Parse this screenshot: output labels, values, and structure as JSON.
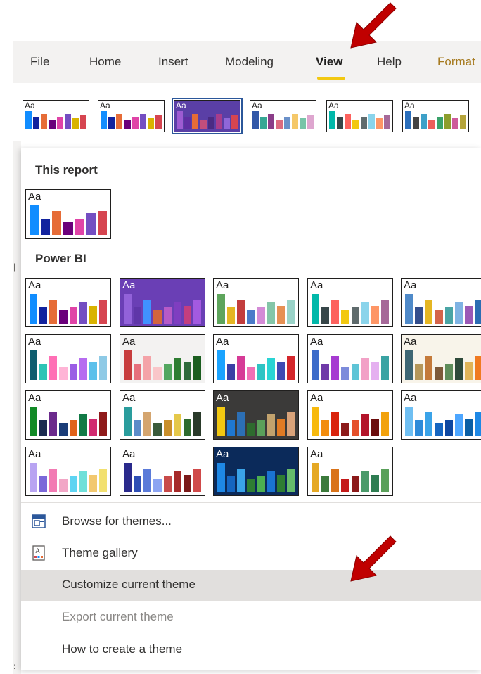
{
  "ribbon": {
    "tabs": [
      "File",
      "Home",
      "Insert",
      "Modeling",
      "View",
      "Help",
      "Format"
    ],
    "active_tab": "View",
    "gallery_thumbs": [
      {
        "label": "Aa",
        "bg": "#ffffff",
        "text": "#201f1e",
        "bars": [
          [
            "#118dff",
            100
          ],
          [
            "#12239e",
            70
          ],
          [
            "#e66c37",
            85
          ],
          [
            "#6b007b",
            55
          ],
          [
            "#e044a7",
            70
          ],
          [
            "#744ec2",
            85
          ],
          [
            "#d9b300",
            60
          ],
          [
            "#d64550",
            80
          ]
        ]
      },
      {
        "label": "Aa",
        "bg": "#ffffff",
        "text": "#201f1e",
        "bars": [
          [
            "#118dff",
            100
          ],
          [
            "#12239e",
            70
          ],
          [
            "#e66c37",
            85
          ],
          [
            "#6b007b",
            55
          ],
          [
            "#e044a7",
            70
          ],
          [
            "#744ec2",
            85
          ],
          [
            "#d9b300",
            60
          ],
          [
            "#d64550",
            80
          ]
        ]
      },
      {
        "label": "Aa",
        "bg": "#5a3fa6",
        "text": "#ffffff",
        "bars": [
          [
            "#9d5bd2",
            100
          ],
          [
            "#5f2ea3",
            70
          ],
          [
            "#e66c37",
            85
          ],
          [
            "#c24e7c",
            55
          ],
          [
            "#4a2b83",
            70
          ],
          [
            "#a73d8c",
            85
          ],
          [
            "#8f66d8",
            60
          ],
          [
            "#d64550",
            80
          ]
        ]
      },
      {
        "label": "Aa",
        "bg": "#ffffff",
        "text": "#201f1e",
        "bars": [
          [
            "#3257a8",
            100
          ],
          [
            "#37a794",
            70
          ],
          [
            "#8b3d88",
            85
          ],
          [
            "#dd6b7f",
            55
          ],
          [
            "#6b91c9",
            70
          ],
          [
            "#f5c869",
            85
          ],
          [
            "#77c4a8",
            60
          ],
          [
            "#dea6cf",
            80
          ]
        ]
      },
      {
        "label": "Aa",
        "bg": "#ffffff",
        "text": "#201f1e",
        "bars": [
          [
            "#01b8aa",
            100
          ],
          [
            "#374649",
            70
          ],
          [
            "#fd625e",
            85
          ],
          [
            "#f2c80f",
            55
          ],
          [
            "#5f6b6d",
            70
          ],
          [
            "#8ad4eb",
            85
          ],
          [
            "#fe9666",
            60
          ],
          [
            "#a66999",
            80
          ]
        ]
      },
      {
        "label": "Aa",
        "bg": "#ffffff",
        "text": "#201f1e",
        "bars": [
          [
            "#2a6ebb",
            100
          ],
          [
            "#444444",
            70
          ],
          [
            "#3da0c8",
            85
          ],
          [
            "#ee5f5b",
            55
          ],
          [
            "#39a26a",
            70
          ],
          [
            "#8d9e2d",
            85
          ],
          [
            "#ce5b9a",
            60
          ],
          [
            "#b5a43a",
            80
          ]
        ]
      }
    ]
  },
  "panel": {
    "this_report_title": "This report",
    "this_report_thumb": {
      "label": "Aa",
      "bg": "#ffffff",
      "text": "#201f1e",
      "bars": [
        [
          "#118dff",
          100
        ],
        [
          "#12239e",
          55
        ],
        [
          "#e66c37",
          80
        ],
        [
          "#6b007b",
          45
        ],
        [
          "#e044a7",
          55
        ],
        [
          "#744ec2",
          75
        ],
        [
          "#d64550",
          80
        ]
      ]
    },
    "power_bi_title": "Power BI",
    "power_bi_thumbs": [
      {
        "label": "Aa",
        "bg": "#ffffff",
        "text": "#201f1e",
        "bars": [
          [
            "#118dff",
            100
          ],
          [
            "#12239e",
            55
          ],
          [
            "#e66c37",
            80
          ],
          [
            "#6b007b",
            45
          ],
          [
            "#e044a7",
            55
          ],
          [
            "#744ec2",
            75
          ],
          [
            "#d9b300",
            60
          ],
          [
            "#d64550",
            80
          ]
        ]
      },
      {
        "label": "Aa",
        "bg": "#6a3fb5",
        "text": "#ffffff",
        "bars": [
          [
            "#9262d9",
            100
          ],
          [
            "#5f36a8",
            55
          ],
          [
            "#4092ff",
            80
          ],
          [
            "#d4653e",
            45
          ],
          [
            "#b75ac7",
            55
          ],
          [
            "#7f3ec0",
            75
          ],
          [
            "#c43e7f",
            60
          ],
          [
            "#a35ae0",
            80
          ]
        ]
      },
      {
        "label": "Aa",
        "bg": "#ffffff",
        "text": "#201f1e",
        "bars": [
          [
            "#5ea55c",
            100
          ],
          [
            "#e5b623",
            55
          ],
          [
            "#c33d3d",
            80
          ],
          [
            "#4a7bc9",
            45
          ],
          [
            "#d48bd6",
            55
          ],
          [
            "#84c6a8",
            75
          ],
          [
            "#e69054",
            60
          ],
          [
            "#9ad3c8",
            80
          ]
        ]
      },
      {
        "label": "Aa",
        "bg": "#ffffff",
        "text": "#201f1e",
        "bars": [
          [
            "#01b8aa",
            100
          ],
          [
            "#374649",
            55
          ],
          [
            "#fd625e",
            80
          ],
          [
            "#f2c80f",
            45
          ],
          [
            "#5f6b6d",
            55
          ],
          [
            "#8ad4eb",
            75
          ],
          [
            "#fe9666",
            60
          ],
          [
            "#a66999",
            80
          ]
        ]
      },
      {
        "label": "Aa",
        "bg": "#ffffff",
        "text": "#201f1e",
        "bars": [
          [
            "#4f8ac9",
            100
          ],
          [
            "#344e8c",
            55
          ],
          [
            "#e5b623",
            80
          ],
          [
            "#d4644b",
            45
          ],
          [
            "#4aa5a5",
            55
          ],
          [
            "#7fb3e3",
            75
          ],
          [
            "#9b59b6",
            60
          ],
          [
            "#2c6db3",
            80
          ]
        ]
      },
      {
        "label": "Aa",
        "bg": "#ffffff",
        "text": "#201f1e",
        "bars": [
          [
            "#0e5e6f",
            100
          ],
          [
            "#2ec4b6",
            55
          ],
          [
            "#ff6fb5",
            80
          ],
          [
            "#ffb4d6",
            45
          ],
          [
            "#9b5de5",
            55
          ],
          [
            "#b66cf0",
            75
          ],
          [
            "#5bc0eb",
            60
          ],
          [
            "#8ecae6",
            80
          ]
        ]
      },
      {
        "label": "Aa",
        "bg": "#f3f2f1",
        "text": "#201f1e",
        "bars": [
          [
            "#c73d3d",
            100
          ],
          [
            "#e6707c",
            55
          ],
          [
            "#f4a3a8",
            80
          ],
          [
            "#f9c6c9",
            45
          ],
          [
            "#53a65f",
            55
          ],
          [
            "#2e7d32",
            75
          ],
          [
            "#2f6b3c",
            60
          ],
          [
            "#1b5e20",
            80
          ]
        ]
      },
      {
        "label": "Aa",
        "bg": "#ffffff",
        "text": "#201f1e",
        "bars": [
          [
            "#1aa3ff",
            100
          ],
          [
            "#3b3fa5",
            55
          ],
          [
            "#d63a96",
            80
          ],
          [
            "#f06fb5",
            45
          ],
          [
            "#2ec4c4",
            55
          ],
          [
            "#2ad4d4",
            75
          ],
          [
            "#3f4ab3",
            60
          ],
          [
            "#d4262b",
            80
          ]
        ]
      },
      {
        "label": "Aa",
        "bg": "#ffffff",
        "text": "#201f1e",
        "bars": [
          [
            "#3c6bc9",
            100
          ],
          [
            "#6f3aa8",
            55
          ],
          [
            "#a63bd1",
            80
          ],
          [
            "#7c8bdb",
            45
          ],
          [
            "#5ec4d6",
            55
          ],
          [
            "#f2a1c6",
            75
          ],
          [
            "#e5b0f0",
            60
          ],
          [
            "#3aa3a3",
            80
          ]
        ]
      },
      {
        "label": "Aa",
        "bg": "#f8f4ea",
        "text": "#201f1e",
        "bars": [
          [
            "#3e6673",
            100
          ],
          [
            "#b5975a",
            55
          ],
          [
            "#c47a3a",
            80
          ],
          [
            "#7d5a3a",
            45
          ],
          [
            "#5e8c5a",
            55
          ],
          [
            "#2e4a3a",
            75
          ],
          [
            "#e0b458",
            60
          ],
          [
            "#f07a20",
            80
          ]
        ]
      },
      {
        "label": "Aa",
        "bg": "#ffffff",
        "text": "#201f1e",
        "bars": [
          [
            "#118a26",
            100
          ],
          [
            "#1b2c4f",
            55
          ],
          [
            "#6b2a8c",
            80
          ],
          [
            "#1a3d78",
            45
          ],
          [
            "#e0621a",
            55
          ],
          [
            "#117a46",
            75
          ],
          [
            "#d12a6f",
            60
          ],
          [
            "#8f1a1a",
            80
          ]
        ]
      },
      {
        "label": "Aa",
        "bg": "#ffffff",
        "text": "#201f1e",
        "bars": [
          [
            "#2a9d9d",
            100
          ],
          [
            "#5b8cc9",
            55
          ],
          [
            "#d4a56f",
            80
          ],
          [
            "#3a5a3a",
            45
          ],
          [
            "#c98f2a",
            55
          ],
          [
            "#e5c84a",
            75
          ],
          [
            "#2e6b2e",
            60
          ],
          [
            "#2a3a2a",
            80
          ]
        ]
      },
      {
        "label": "Aa",
        "bg": "#3b3a39",
        "text": "#ffffff",
        "bars": [
          [
            "#f2c811",
            100
          ],
          [
            "#1f78d1",
            55
          ],
          [
            "#2c6fb5",
            80
          ],
          [
            "#2e6b2e",
            45
          ],
          [
            "#5aa05a",
            55
          ],
          [
            "#c2a26d",
            75
          ],
          [
            "#e07b24",
            60
          ],
          [
            "#d9a37a",
            80
          ]
        ]
      },
      {
        "label": "Aa",
        "bg": "#ffffff",
        "text": "#201f1e",
        "bars": [
          [
            "#f7b90d",
            100
          ],
          [
            "#f28c0d",
            55
          ],
          [
            "#d9240d",
            80
          ],
          [
            "#8c1a1a",
            45
          ],
          [
            "#e5502a",
            55
          ],
          [
            "#b3142a",
            75
          ],
          [
            "#6b0d0d",
            60
          ],
          [
            "#f2a20d",
            80
          ]
        ]
      },
      {
        "label": "Aa",
        "bg": "#ffffff",
        "text": "#201f1e",
        "bars": [
          [
            "#6fbff2",
            100
          ],
          [
            "#2e8bd9",
            55
          ],
          [
            "#3aa3e8",
            80
          ],
          [
            "#1565c0",
            45
          ],
          [
            "#0d47a1",
            55
          ],
          [
            "#4da6ff",
            75
          ],
          [
            "#0b5fa5",
            60
          ],
          [
            "#1e88e5",
            80
          ]
        ]
      },
      {
        "label": "Aa",
        "bg": "#ffffff",
        "text": "#201f1e",
        "bars": [
          [
            "#b8a4f2",
            100
          ],
          [
            "#7b68d9",
            55
          ],
          [
            "#f27ab3",
            80
          ],
          [
            "#f2a6c6",
            45
          ],
          [
            "#5ed4f2",
            55
          ],
          [
            "#6fe0d9",
            75
          ],
          [
            "#f2c86f",
            60
          ],
          [
            "#f2e06f",
            80
          ]
        ]
      },
      {
        "label": "Aa",
        "bg": "#ffffff",
        "text": "#201f1e",
        "bars": [
          [
            "#2a2a8c",
            100
          ],
          [
            "#2f4fb5",
            55
          ],
          [
            "#5b7bd9",
            80
          ],
          [
            "#8ca4f2",
            45
          ],
          [
            "#c84a4a",
            55
          ],
          [
            "#a62a2a",
            75
          ],
          [
            "#7a1a1a",
            60
          ],
          [
            "#d04a4a",
            80
          ]
        ]
      },
      {
        "label": "Aa",
        "bg": "#0b2a5a",
        "text": "#ffffff",
        "bars": [
          [
            "#1e88e5",
            100
          ],
          [
            "#1565c0",
            55
          ],
          [
            "#3aa3e8",
            80
          ],
          [
            "#2e7d32",
            45
          ],
          [
            "#4caf50",
            55
          ],
          [
            "#1a73d1",
            75
          ],
          [
            "#2e7d32",
            60
          ],
          [
            "#66bb6a",
            80
          ]
        ]
      },
      {
        "label": "Aa",
        "bg": "#ffffff",
        "text": "#201f1e",
        "bars": [
          [
            "#e5a823",
            100
          ],
          [
            "#3c7a3c",
            55
          ],
          [
            "#d9731a",
            80
          ],
          [
            "#c41a1a",
            45
          ],
          [
            "#8c1a1a",
            55
          ],
          [
            "#4a9a6a",
            75
          ],
          [
            "#2e7d52",
            60
          ],
          [
            "#5aa05a",
            80
          ]
        ]
      }
    ],
    "menu": {
      "browse": "Browse for themes...",
      "gallery": "Theme gallery",
      "customize": "Customize current theme",
      "export": "Export current theme",
      "how_to": "How to create a theme"
    }
  }
}
